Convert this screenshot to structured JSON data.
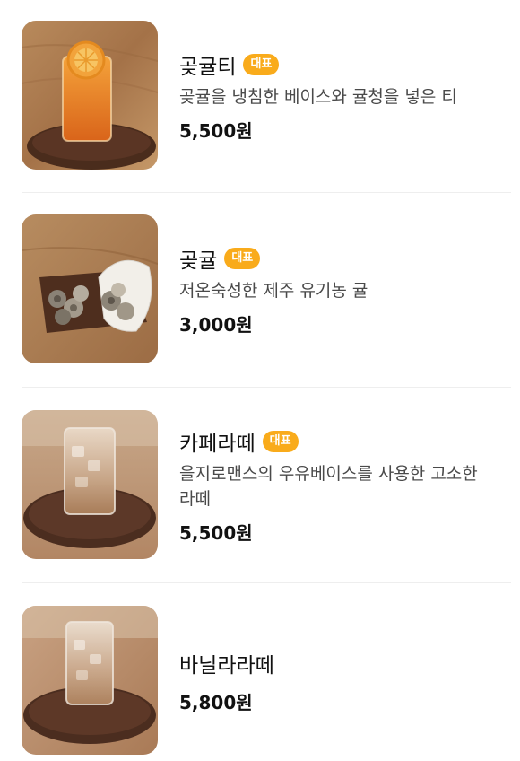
{
  "menu": {
    "items": [
      {
        "name": "곶귤티",
        "badge": "대표",
        "description": "곶귤을 냉침한 베이스와 귤청을 넣은 티",
        "price": "5,500원",
        "image": "citrus-tea-photo"
      },
      {
        "name": "곶귤",
        "badge": "대표",
        "description": "저온숙성한 제주 유기농 귤",
        "price": "3,000원",
        "image": "dried-citrus-photo"
      },
      {
        "name": "카페라떼",
        "badge": "대표",
        "description": "을지로맨스의 우유베이스를 사용한 고소한 라떼",
        "price": "5,500원",
        "image": "cafe-latte-photo"
      },
      {
        "name": "바닐라라떼",
        "price": "5,800원",
        "image": "vanilla-latte-photo"
      }
    ]
  },
  "colors": {
    "badge_bg": "#f9ab1b",
    "divider": "#eeeeee",
    "text_primary": "#111111",
    "text_secondary": "#4a4a4a"
  }
}
